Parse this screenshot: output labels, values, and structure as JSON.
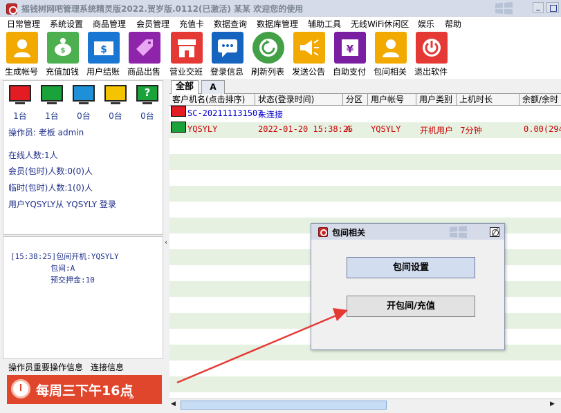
{
  "window": {
    "title": "摇钱树网吧管理系统精灵版2022.贺岁版.0112(已激活)  某某 欢迎您的使用"
  },
  "menu": [
    "日常管理",
    "系统设置",
    "商品管理",
    "会员管理",
    "充值卡",
    "数据查询",
    "数据库管理",
    "辅助工具",
    "无线WiFi休闲区",
    "娱乐",
    "帮助"
  ],
  "toolbar": [
    {
      "label": "生成帐号",
      "icon": "user-icon",
      "color": "#f2a900"
    },
    {
      "label": "充值加钱",
      "icon": "piggy-bank-icon",
      "color": "#4caf50"
    },
    {
      "label": "用户结账",
      "icon": "dollar-card-icon",
      "color": "#1976d2"
    },
    {
      "label": "商品出售",
      "icon": "sale-tag-icon",
      "color": "#8e24aa"
    },
    {
      "label": "营业交班",
      "icon": "store-icon",
      "color": "#e53935"
    },
    {
      "label": "登录信息",
      "icon": "chat-icon",
      "color": "#1565c0"
    },
    {
      "label": "刷新列表",
      "icon": "refresh-icon",
      "color": "#43a047"
    },
    {
      "label": "发送公告",
      "icon": "megaphone-icon",
      "color": "#f2a900"
    },
    {
      "label": "自助支付",
      "icon": "yen-icon",
      "color": "#7b1fa2"
    },
    {
      "label": "包间相关",
      "icon": "user-icon",
      "color": "#f2a900"
    },
    {
      "label": "退出软件",
      "icon": "power-icon",
      "color": "#e53935"
    }
  ],
  "monitors": [
    {
      "count": "1台",
      "color": "#e31b23",
      "icon": "red-monitor-icon"
    },
    {
      "count": "1台",
      "color": "#1aa33a",
      "icon": "green-monitor-icon"
    },
    {
      "count": "0台",
      "color": "#1e90d8",
      "icon": "blue-monitor-icon"
    },
    {
      "count": "0台",
      "color": "#f5c400",
      "icon": "yellow-monitor-icon"
    },
    {
      "count": "0台",
      "color": "#1aa33a",
      "icon": "unknown-monitor-icon"
    }
  ],
  "status": {
    "operator": "操作员:  老板 admin",
    "online": "在线人数:1人",
    "members": "会员(包时)人数:0(0)人",
    "temp": "临时(包时)人数:1(0)人",
    "login": "用户YQSYLY从 YQSYLY 登录"
  },
  "log": {
    "line1": "[15:38:25]包间开机:YQSYLY",
    "line2": "包间:A",
    "line3": "预交押金:10"
  },
  "bottom_tabs": {
    "t1": "操作员重要操作信息",
    "t2": "连接信息"
  },
  "banner": {
    "text": "每周三下午16点"
  },
  "tabs": {
    "all": "全部",
    "a": "A"
  },
  "columns": [
    "客户机名(点击排序)",
    "状态(登录时间)",
    "分区",
    "用户帐号",
    "用户类别",
    "上机时长",
    "余额/余时"
  ],
  "rows": [
    {
      "name": "SC-202111131507",
      "status": "未连接",
      "zone": "",
      "account": "",
      "type": "",
      "duration": "",
      "balance": "",
      "status_color": "#0000cc",
      "icon_color": "#e31b23"
    },
    {
      "name": "YQSYLY",
      "status": "2022-01-20 15:38:25",
      "zone": "A",
      "account": "YQSYLY",
      "type": "开机用户",
      "duration": "7分钟",
      "balance": "0.00(294",
      "status_color": "#cc0000",
      "icon_color": "#1aa33a"
    }
  ],
  "dialog": {
    "title": "包间相关",
    "btn1": "包间设置",
    "btn2": "开包间/充值"
  }
}
